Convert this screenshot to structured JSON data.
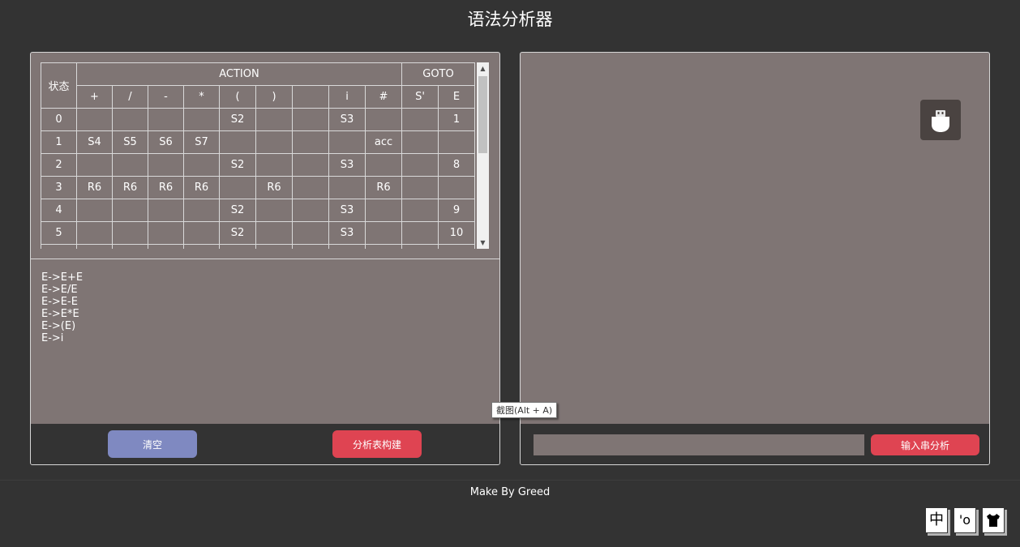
{
  "app": {
    "title": "语法分析器"
  },
  "table": {
    "state_header": "状态",
    "action_header": "ACTION",
    "goto_header": "GOTO",
    "action_cols": [
      "+",
      "/",
      "-",
      "*",
      "(",
      ")",
      "",
      "i",
      "#"
    ],
    "goto_cols": [
      "S'",
      "E"
    ],
    "rows": [
      [
        "0",
        "",
        "",
        "",
        "",
        "S2",
        "",
        "",
        "S3",
        "",
        "",
        "1"
      ],
      [
        "1",
        "S4",
        "S5",
        "S6",
        "S7",
        "",
        "",
        "",
        "",
        "acc",
        "",
        ""
      ],
      [
        "2",
        "",
        "",
        "",
        "",
        "S2",
        "",
        "",
        "S3",
        "",
        "",
        "8"
      ],
      [
        "3",
        "R6",
        "R6",
        "R6",
        "R6",
        "",
        "R6",
        "",
        "",
        "R6",
        "",
        ""
      ],
      [
        "4",
        "",
        "",
        "",
        "",
        "S2",
        "",
        "",
        "S3",
        "",
        "",
        "9"
      ],
      [
        "5",
        "",
        "",
        "",
        "",
        "S2",
        "",
        "",
        "S3",
        "",
        "",
        "10"
      ],
      [
        "",
        "",
        "",
        "",
        "",
        "",
        "",
        "",
        "",
        "",
        "",
        ""
      ]
    ]
  },
  "grammar": {
    "text": "E->E+E\nE->E/E\nE->E-E\nE->E*E\nE->(E)\nE->i"
  },
  "buttons": {
    "clear": "清空",
    "build": "分析表构建",
    "analyze": "输入串分析"
  },
  "input": {
    "value": "",
    "placeholder": ""
  },
  "tooltip": {
    "text": "截图(Alt + A)"
  },
  "footer": {
    "credit": "Make By Greed"
  },
  "widgets": [
    "中",
    "'o",
    "shirt-icon"
  ],
  "icons": {
    "right_panel_icon": "usb-drive-icon"
  },
  "colors": {
    "background": "#333333",
    "panel": "#7f7574",
    "clear_button": "#7f89c1",
    "accent_red": "#df4452"
  }
}
